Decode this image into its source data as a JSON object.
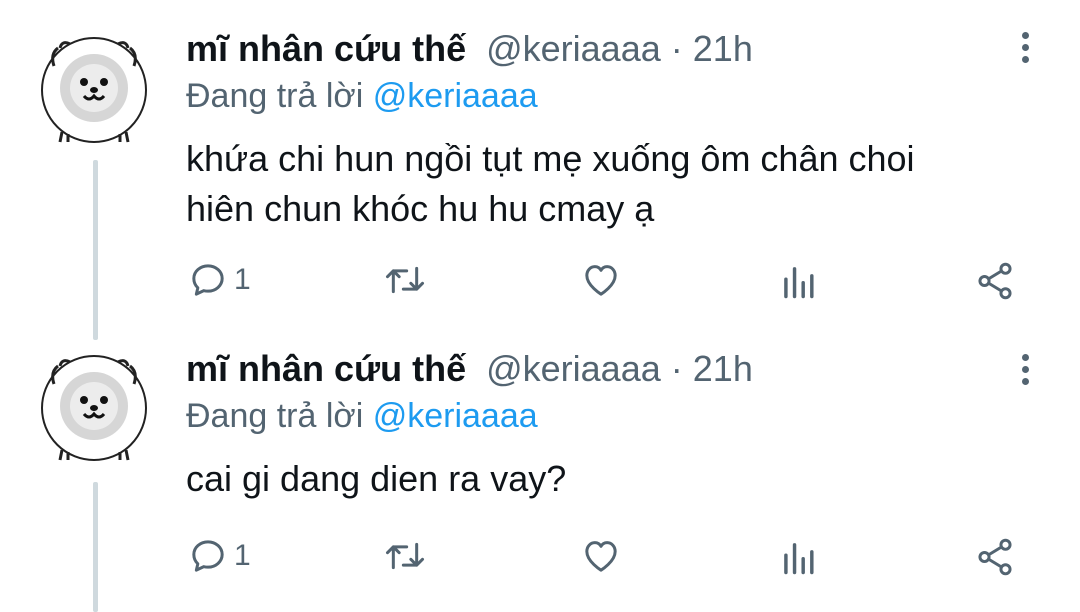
{
  "tweets": [
    {
      "author_name": "mĩ nhân cứu thế",
      "handle": "@keriaaaa",
      "separator": "·",
      "time": "21h",
      "replying_prefix": "Đang trả lời",
      "replying_to": "@keriaaaa",
      "text_lines": [
        "khứa chi hun ngồi tụt mẹ xuống ôm chân choi",
        "hiên chun khóc hu hu cmay ạ"
      ],
      "reply_count": "1",
      "icons": [
        "reply-icon",
        "retweet-icon",
        "like-icon",
        "analytics-icon",
        "share-icon",
        "more-icon"
      ]
    },
    {
      "author_name": "mĩ nhân cứu thế",
      "handle": "@keriaaaa",
      "separator": "·",
      "time": "21h",
      "replying_prefix": "Đang trả lời",
      "replying_to": "@keriaaaa",
      "text_lines": [
        "cai gi dang dien ra vay?"
      ],
      "reply_count": "1",
      "icons": [
        "reply-icon",
        "retweet-icon",
        "like-icon",
        "analytics-icon",
        "share-icon",
        "more-icon"
      ]
    }
  ],
  "colors": {
    "text": "#0f1419",
    "secondary": "#536471",
    "mention": "#1d9bf0",
    "thread_line": "#cfd9de"
  }
}
